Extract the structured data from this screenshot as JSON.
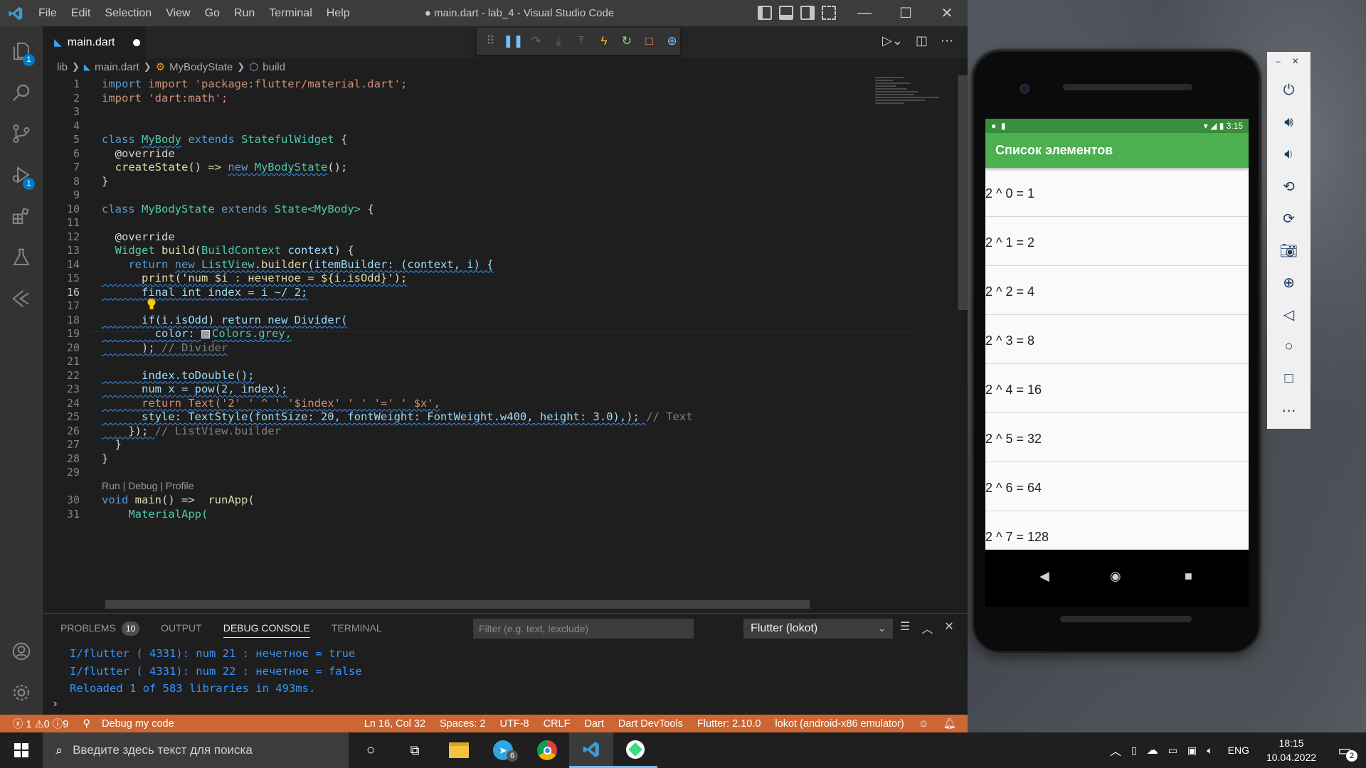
{
  "window": {
    "title": "● main.dart - lab_4 - Visual Studio Code",
    "menu": [
      "File",
      "Edit",
      "Selection",
      "View",
      "Go",
      "Run",
      "Terminal",
      "Help"
    ]
  },
  "activity": {
    "explorer_badge": "1",
    "debug_badge": "1"
  },
  "tabs": [
    {
      "label": "main.dart",
      "dirty": true
    }
  ],
  "breadcrumb": {
    "folder": "lib",
    "file": "main.dart",
    "class": "MyBodyState",
    "method": "build"
  },
  "editor": {
    "line_numbers": [
      "1",
      "2",
      "3",
      "4",
      "5",
      "6",
      "7",
      "8",
      "9",
      "10",
      "11",
      "12",
      "13",
      "14",
      "15",
      "16",
      "17",
      "18",
      "19",
      "20",
      "21",
      "22",
      "23",
      "24",
      "25",
      "26",
      "27",
      "28",
      "29",
      "30",
      "31"
    ],
    "active_line": "16",
    "codelens": "Run | Debug | Profile",
    "lines": {
      "l1": "import 'package:flutter/material.dart';",
      "l2": "import 'dart:math';",
      "l5_kw": "class ",
      "l5_name": "MyBody",
      "l5_ext": " extends ",
      "l5_type": "StatefulWidget",
      "l5_end": " {",
      "l6": "  @override",
      "l7_a": "  createState() => ",
      "l7_new": "new",
      "l7_b": " MyBodyState",
      "l7_c": "();",
      "l8": "}",
      "l10_kw": "class ",
      "l10_name": "MyBodyState",
      "l10_ext": " extends ",
      "l10_type": "State",
      "l10_gen": "<MyBody>",
      "l10_end": " {",
      "l12": "  @override",
      "l13_type": "  Widget",
      "l13_fn": " build",
      "l13_p": "(",
      "l13_ptype": "BuildContext",
      "l13_pvar": " context",
      "l13_end": ") {",
      "l14_ret": "    return ",
      "l14_new": "new",
      "l14_cls": " ListView",
      "l14_fn": ".builder",
      "l14_rest": "(itemBuilder: (context, i) {",
      "l15": "      print('num $i : нечетное = ${i.isOdd}');",
      "l16": "      final int index = i ~/ 2;",
      "l18": "      if(i.isOdd) return new Divider(",
      "l19_a": "        color: ",
      "l19_b": "Colors.grey,",
      "l20_a": "      ); ",
      "l20_cm": "// Divider",
      "l22": "      index.toDouble();",
      "l23": "      num x = pow(2, index);",
      "l24": "      return Text('2' ' ^ ' '$index' ' ' '=' ' $x',",
      "l25_a": "      style: TextStyle(fontSize: 20, fontWeight: FontWeight.w400, height: 3.0),); ",
      "l25_cm": "// Text",
      "l26_a": "    }); ",
      "l26_cm": "// ListView.builder",
      "l27": "  }",
      "l28": "}",
      "l30_kw": "void",
      "l30_fn": " main",
      "l30_rest": "() =>  ",
      "l30_fn2": "runApp",
      "l30_end": "(",
      "l31": "    MaterialApp("
    }
  },
  "panel": {
    "tabs": [
      "PROBLEMS",
      "OUTPUT",
      "DEBUG CONSOLE",
      "TERMINAL"
    ],
    "active_tab": "DEBUG CONSOLE",
    "problems_count": "10",
    "filter_placeholder": "Filter (e.g. text, !exclude)",
    "session": "Flutter (lokot)",
    "console": [
      "I/flutter ( 4331): num 21 : нечетное = true",
      "I/flutter ( 4331): num 22 : нечетное = false",
      "Reloaded 1 of 583 libraries in 493ms."
    ]
  },
  "statusbar": {
    "errors": "1",
    "warnings": "0",
    "info": "9",
    "debug": "Debug my code",
    "position": "Ln 16, Col 32",
    "spaces": "Spaces: 2",
    "encoding": "UTF-8",
    "eol": "CRLF",
    "language": "Dart",
    "devtools": "Dart DevTools",
    "flutter": "Flutter: 2.10.0",
    "device": "lokot (android-x86 emulator)"
  },
  "phone": {
    "time": "3:15",
    "app_title": "Список элементов",
    "items": [
      "2 ^ 0 = 1",
      "2 ^ 1 = 2",
      "2 ^ 2 = 4",
      "2 ^ 3 = 8",
      "2 ^ 4 = 16",
      "2 ^ 5 = 32",
      "2 ^ 6 = 64",
      "2 ^ 7 = 128"
    ]
  },
  "taskbar": {
    "search_placeholder": "Введите здесь текст для поиска",
    "chat_badge": "6",
    "lang": "ENG",
    "time": "18:15",
    "date": "10.04.2022",
    "notifications": "2"
  },
  "colors": {
    "statusbar": "#cc6633",
    "appbar": "#4caf50",
    "android_status": "#388e3c",
    "accent": "#007acc"
  }
}
